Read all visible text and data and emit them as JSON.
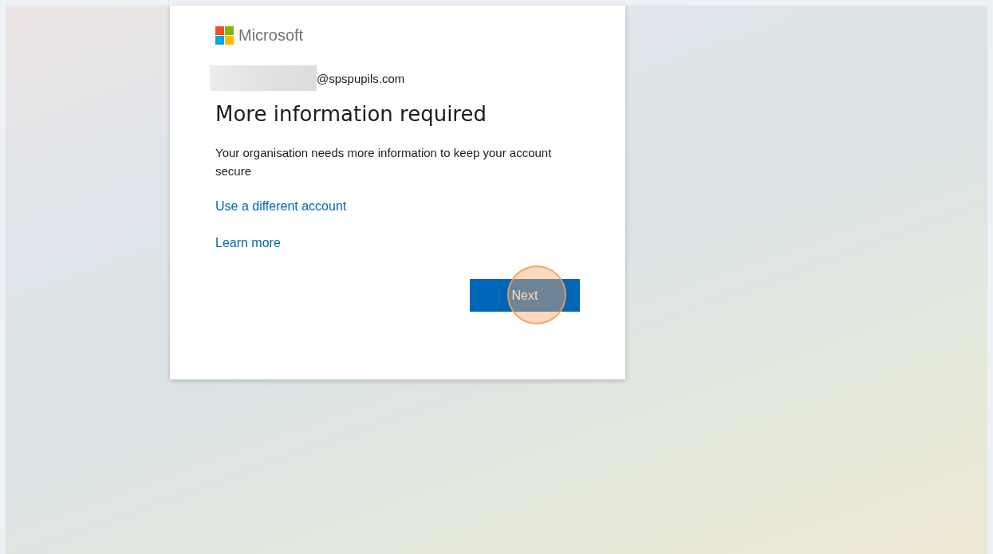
{
  "brand": {
    "name": "Microsoft"
  },
  "account": {
    "email": "@spspupils.com"
  },
  "heading": "More information required",
  "message": "Your organisation needs more information to keep your account secure",
  "links": [
    "Use a different account",
    "Learn more"
  ],
  "primary_button": {
    "label": "Next",
    "highlighted": true
  }
}
